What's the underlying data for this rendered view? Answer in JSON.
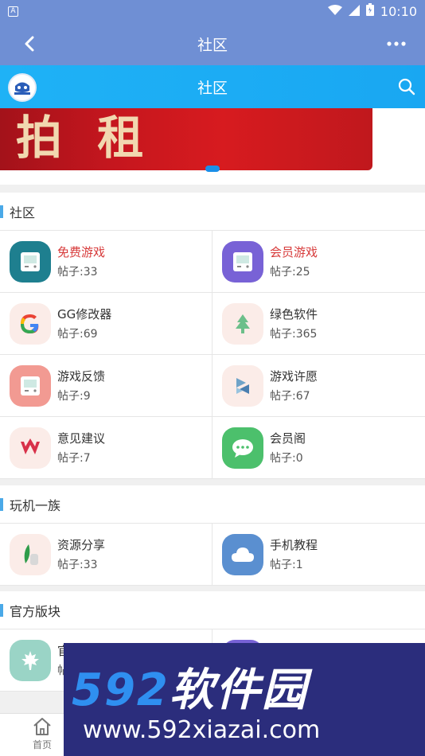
{
  "statusbar": {
    "app_badge": "A",
    "time": "10:10"
  },
  "titlebar": {
    "title": "社区"
  },
  "subbar": {
    "title": "社区"
  },
  "banner": {
    "text": "拍 租"
  },
  "sections": [
    {
      "title": "社区",
      "items": [
        {
          "name": "免费游戏",
          "count": "帖子:33",
          "icon": "gamepad-icon",
          "color": "#1e7f8f",
          "red": true
        },
        {
          "name": "会员游戏",
          "count": "帖子:25",
          "icon": "gamepad-icon",
          "color": "#7862d6",
          "red": true
        },
        {
          "name": "GG修改器",
          "count": "帖子:69",
          "icon": "google-g-icon",
          "color": "#fbece8",
          "red": false
        },
        {
          "name": "绿色软件",
          "count": "帖子:365",
          "icon": "tree-icon",
          "color": "#fbece8",
          "red": false
        },
        {
          "name": "游戏反馈",
          "count": "帖子:9",
          "icon": "gamepad-icon",
          "color": "#f29a92",
          "red": false
        },
        {
          "name": "游戏许愿",
          "count": "帖子:67",
          "icon": "s-logo-icon",
          "color": "#fbece8",
          "red": false
        },
        {
          "name": "意见建议",
          "count": "帖子:7",
          "icon": "w-logo-icon",
          "color": "#fbece8",
          "red": false
        },
        {
          "name": "会员阁",
          "count": "帖子:0",
          "icon": "chat-bubble-icon",
          "color": "#4cc06c",
          "red": false
        }
      ]
    },
    {
      "title": "玩机一族",
      "items": [
        {
          "name": "资源分享",
          "count": "帖子:33",
          "icon": "leaf-icon",
          "color": "#fbece8",
          "red": false
        },
        {
          "name": "手机教程",
          "count": "帖子:1",
          "icon": "cloud-icon",
          "color": "#5a8fd0",
          "red": false
        }
      ]
    },
    {
      "title": "官方版块",
      "items": [
        {
          "name": "官",
          "count": "帖",
          "icon": "maple-leaf-icon",
          "color": "#9ad4c6",
          "red": false
        },
        {
          "name": "",
          "count": "",
          "icon": "gamepad-icon",
          "color": "#7862d6",
          "red": false
        }
      ]
    }
  ],
  "bottom_nav": {
    "home_label": "首页"
  },
  "watermark": {
    "line1_num": "592",
    "line1_text": "软件园",
    "line2": "www.592xiazai.com"
  }
}
